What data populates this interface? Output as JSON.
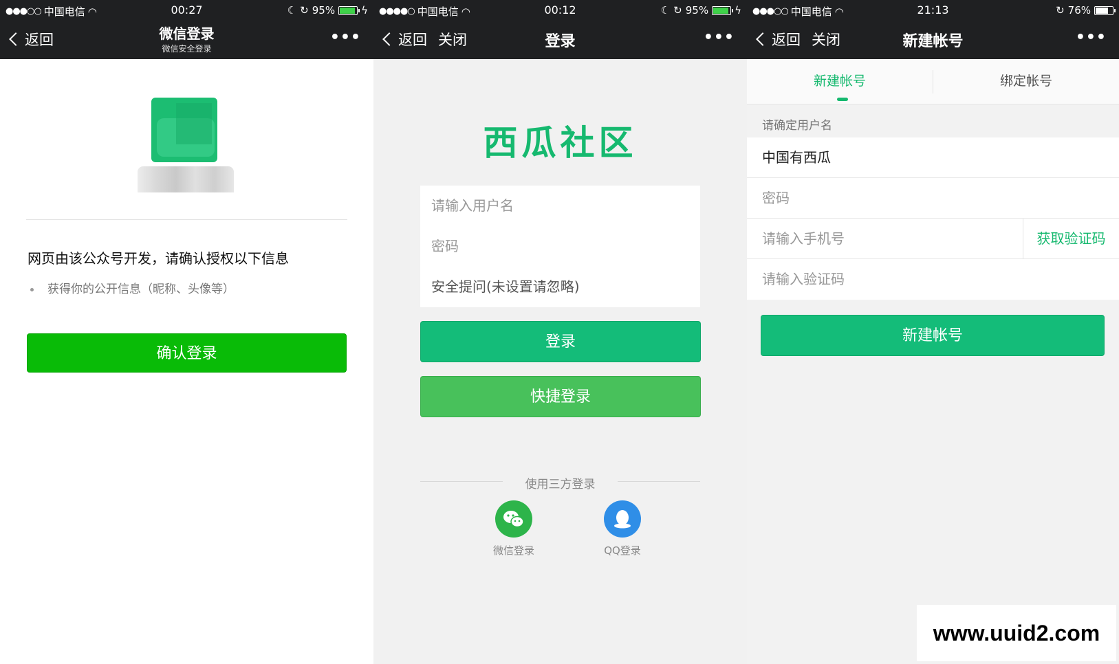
{
  "panels": [
    {
      "status": {
        "signal": "●●●○○",
        "carrier": "中国电信",
        "time": "00:27",
        "battery": "95%"
      },
      "nav": {
        "back": "返回",
        "title": "微信登录",
        "subtitle": "微信安全登录",
        "more": "•••"
      },
      "auth": {
        "title": "网页由该公众号开发，请确认授权以下信息",
        "item": "获得你的公开信息（昵称、头像等）",
        "confirm_button": "确认登录"
      }
    },
    {
      "status": {
        "signal": "●●●●○",
        "carrier": "中国电信",
        "time": "00:12",
        "battery": "95%"
      },
      "nav": {
        "back": "返回",
        "close": "关闭",
        "title": "登录",
        "more": "•••"
      },
      "brand": "西瓜社区",
      "form": {
        "username_placeholder": "请输入用户名",
        "password_placeholder": "密码",
        "security_question": "安全提问(未设置请忽略)"
      },
      "login_button": "登录",
      "quick_login_button": "快捷登录",
      "third_party": {
        "label": "使用三方登录",
        "wechat": "微信登录",
        "qq": "QQ登录"
      }
    },
    {
      "status": {
        "signal": "●●●○○",
        "carrier": "中国电信",
        "time": "21:13",
        "battery": "76%"
      },
      "nav": {
        "back": "返回",
        "close": "关闭",
        "title": "新建帐号",
        "more": "•••"
      },
      "tabs": [
        {
          "label": "新建帐号",
          "active": true
        },
        {
          "label": "绑定帐号",
          "active": false
        }
      ],
      "section_label": "请确定用户名",
      "form": {
        "username_value": "中国有西瓜",
        "password_placeholder": "密码",
        "phone_placeholder": "请输入手机号",
        "sms_button": "获取验证码",
        "code_placeholder": "请输入验证码"
      },
      "create_button": "新建帐号"
    }
  ],
  "watermark": "www.uuid2.com",
  "colors": {
    "green_primary": "#14bc79",
    "green_wechat": "#09bb07",
    "green_quick": "#48c15b",
    "nav_bg": "#1f2022",
    "qq_blue": "#2f8ee7"
  }
}
